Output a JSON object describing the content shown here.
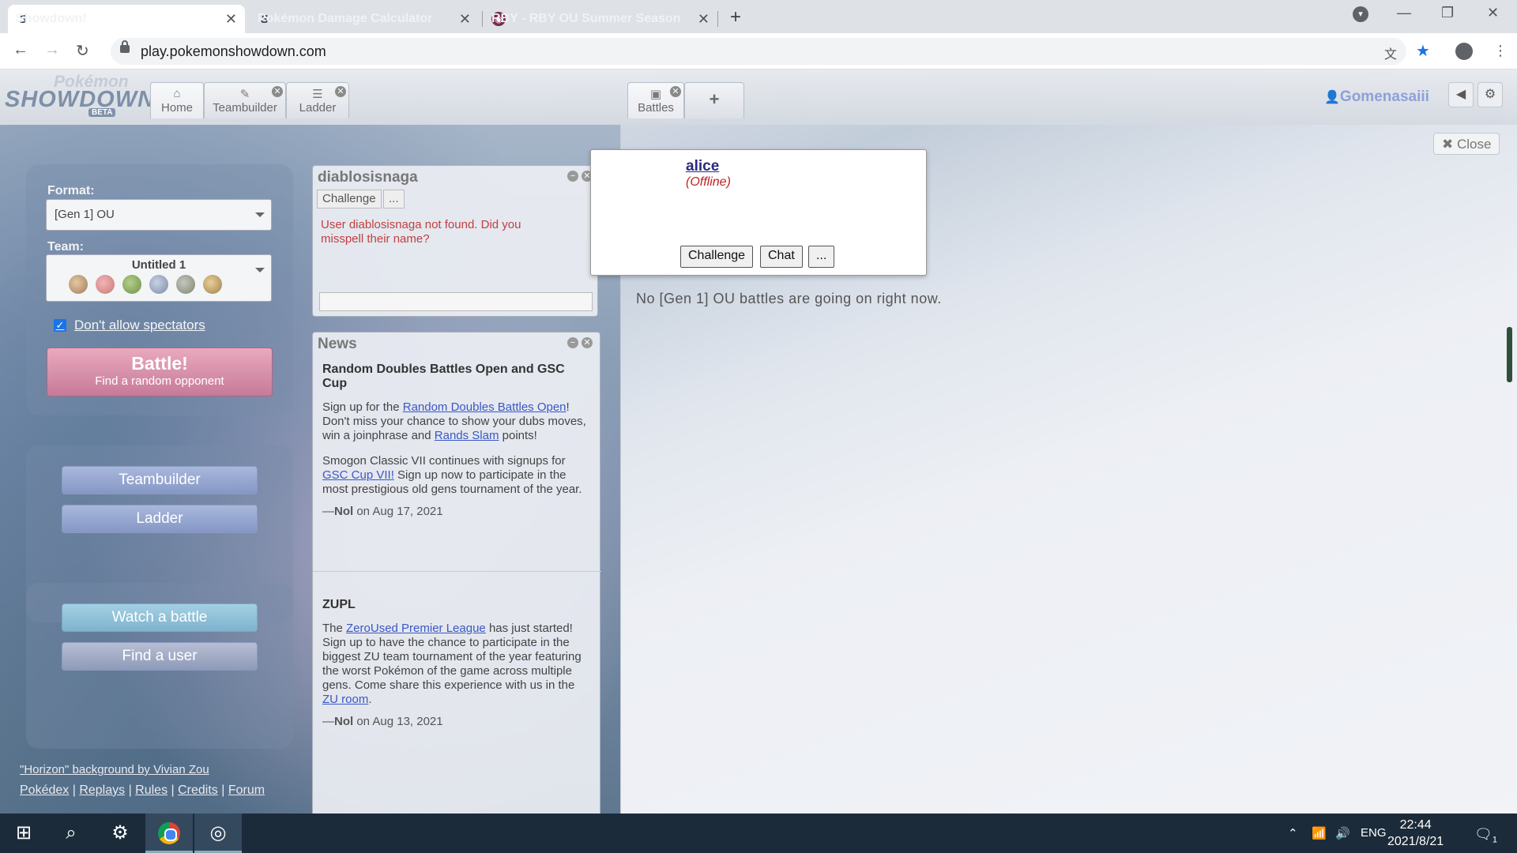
{
  "browser": {
    "tabs": [
      {
        "title": "Showdown!",
        "active": true
      },
      {
        "title": "Pokémon Damage Calculator",
        "active": false
      },
      {
        "title": "RBY - RBY OU Summer Season",
        "active": false
      }
    ],
    "url": "play.pokemonshowdown.com"
  },
  "header": {
    "logo": {
      "line1": "Pokémon",
      "line2": "SHOWDOWN",
      "badge": "BETA"
    },
    "tabs": [
      {
        "label": "Home"
      },
      {
        "label": "Teambuilder"
      },
      {
        "label": "Ladder"
      }
    ],
    "battles_tab": "Battles",
    "add_tab": "+",
    "username": "Gomenasaiii"
  },
  "main_menu": {
    "format_label": "Format:",
    "format_value": "[Gen 1] OU",
    "team_label": "Team:",
    "team_value": "Untitled 1",
    "no_spectators_label": "Don't allow spectators",
    "battle_button": "Battle!",
    "battle_sub": "Find a random opponent",
    "teambuilder_button": "Teambuilder",
    "ladder_button": "Ladder",
    "watch_button": "Watch a battle",
    "find_user_button": "Find a user"
  },
  "footer": {
    "credit": "\"Horizon\" background by Vivian Zou",
    "links": [
      "Pokédex",
      "Replays",
      "Rules",
      "Credits",
      "Forum"
    ]
  },
  "user_window": {
    "title": "diablosisnaga",
    "challenge_button": "Challenge",
    "more_button": "...",
    "message": "User diablosisnaga not found. Did you misspell their name?"
  },
  "news": {
    "title": "News",
    "items": [
      {
        "headline": "Random Doubles Battles Open and GSC Cup",
        "p1_pre": "Sign up for the ",
        "p1_link1": "Random Doubles Battles Open",
        "p1_mid": "! Don't miss your chance to show your dubs moves, win a joinphrase and ",
        "p1_link2": "Rands Slam",
        "p1_post": " points!",
        "p2_pre": "Smogon Classic VII continues with signups for ",
        "p2_link": "GSC Cup VII!",
        "p2_post": " Sign up now to participate in the most prestigious old gens tournament of the year.",
        "byline_pre": "—",
        "author": "Nol",
        "date": " on Aug 17, 2021"
      },
      {
        "headline": "ZUPL",
        "p1_pre": "The ",
        "p1_link1": "ZeroUsed Premier League",
        "p1_mid": " has just started! Sign up to have the chance to participate in the biggest ZU team tournament of the year featuring the worst Pokémon of the game across multiple gens. Come share this experience with us in the ",
        "p1_link2": "ZU room",
        "p1_post": ".",
        "byline_pre": "—",
        "author": "Nol",
        "date": " on Aug 13, 2021"
      }
    ]
  },
  "battles_panel": {
    "close_button": "Close",
    "empty_message": "No [Gen 1] OU battles are going on right now."
  },
  "user_popup": {
    "name": "alice",
    "status": "(Offline)",
    "challenge_button": "Challenge",
    "chat_button": "Chat",
    "more_button": "..."
  },
  "taskbar": {
    "language": "ENG",
    "time": "22:44",
    "date": "2021/8/21",
    "notification_count": "1"
  }
}
